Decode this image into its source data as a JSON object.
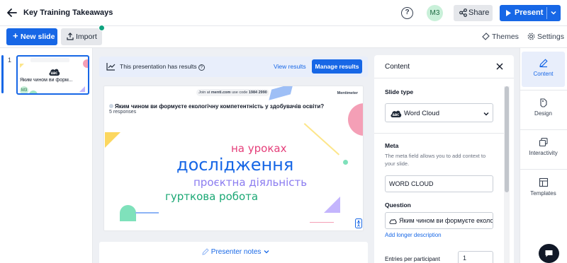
{
  "header": {
    "title": "Key Training Takeaways",
    "avatar_initials": "M3",
    "share_label": "Share",
    "present_label": "Present"
  },
  "toolbar": {
    "new_slide_label": "New slide",
    "import_label": "Import",
    "themes_label": "Themes",
    "settings_label": "Settings"
  },
  "rail": {
    "slides": [
      {
        "number": "1",
        "title": "Яким чином ви форм...",
        "avatar": "M3"
      }
    ]
  },
  "banner": {
    "message": "This presentation has results",
    "view_results": "View results",
    "manage_results": "Manage results"
  },
  "slide": {
    "join_prefix": "Join at",
    "join_site": "menti.com",
    "join_code_label": "use code",
    "join_code": "1984 2990",
    "brand": "Mentimeter",
    "question": "Яким чином ви формуєте екологічну компетентність у здобувачів освіти?",
    "responses": "5 responses",
    "words": [
      {
        "text": "на уроках",
        "color": "#e53f7a"
      },
      {
        "text": "дослідження",
        "color": "#1767e6"
      },
      {
        "text": "проєктна діяльність",
        "color": "#8b7cf0"
      },
      {
        "text": "гурткова робота",
        "color": "#1ba875"
      }
    ]
  },
  "notes": {
    "label": "Presenter notes"
  },
  "panel": {
    "title": "Content",
    "slide_type_label": "Slide type",
    "slide_type_value": "Word Cloud",
    "meta_label": "Meta",
    "meta_description": "The meta field allows you to add context to your slide.",
    "meta_value": "WORD CLOUD",
    "question_label": "Question",
    "question_value": "Яким чином ви формуєте екологічну компетентність у здобувачів освіти?",
    "add_longer_description": "Add longer description",
    "entries_label": "Entries per participant",
    "entries_value": "1"
  },
  "tabs": [
    {
      "label": "Content",
      "icon": "pencil-icon",
      "active": true
    },
    {
      "label": "Design",
      "icon": "palette-icon",
      "active": false
    },
    {
      "label": "Interactivity",
      "icon": "interactivity-icon",
      "active": false
    },
    {
      "label": "Templates",
      "icon": "templates-icon",
      "active": false
    }
  ],
  "colors": {
    "accent": "#1767e6",
    "avatar_bg": "#c9f0d9"
  }
}
